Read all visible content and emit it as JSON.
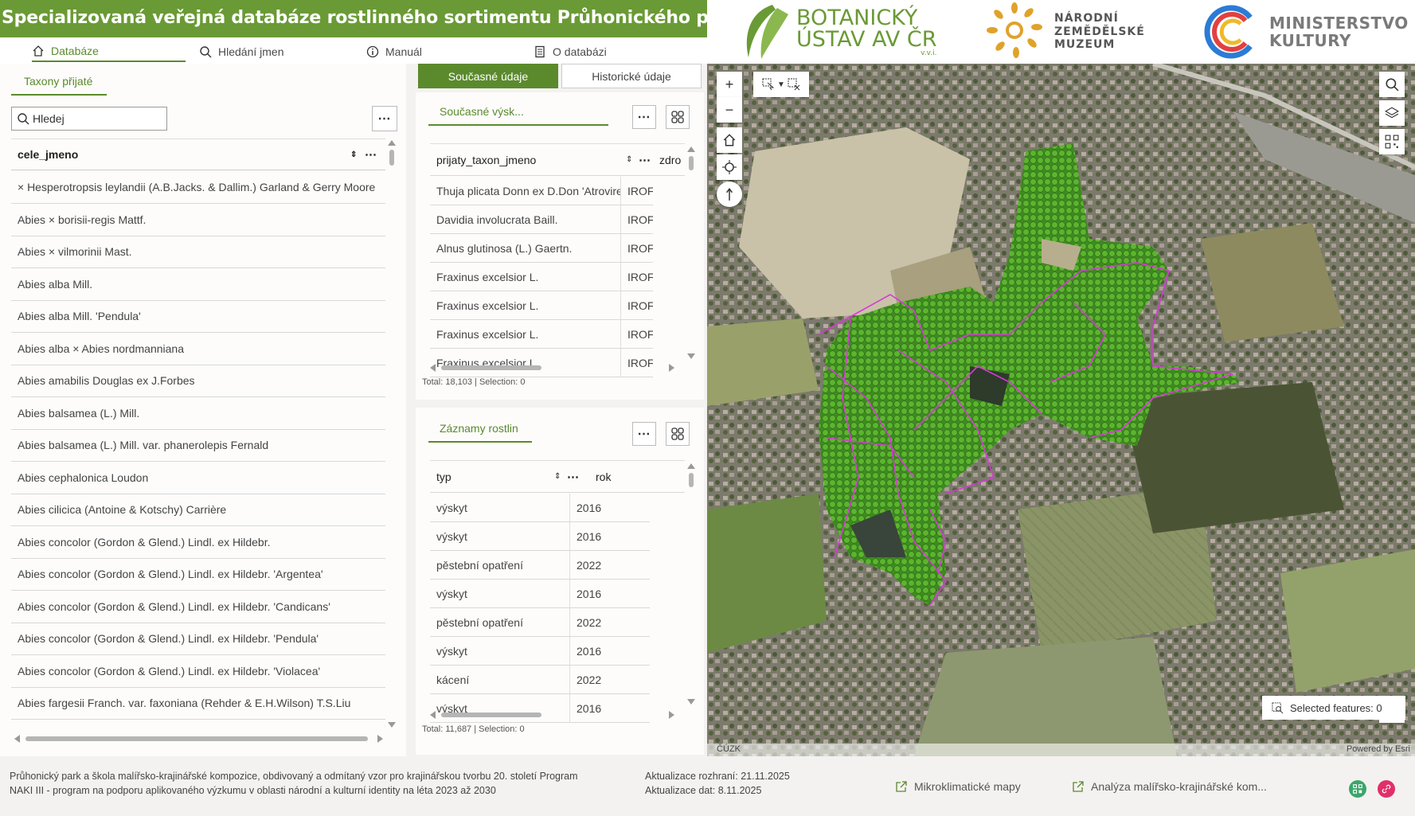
{
  "header": {
    "title": "Specializovaná veřejná databáze rostlinného sortimentu Průhonického parku",
    "accent": "#6a9a35",
    "nav": [
      {
        "label": "Databáze",
        "icon": "home-icon",
        "active": true
      },
      {
        "label": "Hledání jmen",
        "icon": "search-icon",
        "active": false
      },
      {
        "label": "Manuál",
        "icon": "info-icon",
        "active": false
      },
      {
        "label": "O databázi",
        "icon": "document-icon",
        "active": false
      }
    ],
    "logos": {
      "botanicky": {
        "line1": "BOTANICKÝ",
        "line2": "ÚSTAV AV ČR",
        "line3": "v.v.i."
      },
      "muzeum": {
        "line1": "NÁRODNÍ",
        "line2": "ZEMĚDĚLSKÉ",
        "line3": "MUZEUM"
      },
      "ministerstvo": {
        "line1": "MINISTERSTVO",
        "line2": "KULTURY"
      }
    }
  },
  "left_panel": {
    "tab": "Taxony přijaté",
    "search_placeholder": "Hledej",
    "column_header": "cele_jmeno",
    "rows": [
      "× Hesperotropsis leylandii (A.B.Jacks. & Dallim.) Garland & Gerry Moore",
      "Abies × borisii-regis Mattf.",
      "Abies × vilmorinii Mast.",
      "Abies alba Mill.",
      "Abies alba Mill. 'Pendula'",
      "Abies alba × Abies nordmanniana",
      "Abies amabilis Douglas ex J.Forbes",
      "Abies balsamea (L.) Mill.",
      "Abies balsamea (L.) Mill. var. phanerolepis Fernald",
      "Abies cephalonica Loudon",
      "Abies cilicica (Antoine & Kotschy) Carrière",
      "Abies concolor (Gordon & Glend.) Lindl. ex Hildebr.",
      "Abies concolor (Gordon & Glend.) Lindl. ex Hildebr. 'Argentea'",
      "Abies concolor (Gordon & Glend.) Lindl. ex Hildebr. 'Candicans'",
      "Abies concolor (Gordon & Glend.) Lindl. ex Hildebr. 'Pendula'",
      "Abies concolor (Gordon & Glend.) Lindl. ex Hildebr. 'Violacea'",
      "Abies fargesii Franch. var. faxoniana (Rehder & E.H.Wilson) T.S.Liu"
    ]
  },
  "mid_panel": {
    "tabs": [
      "Současné údaje",
      "Historické údaje"
    ],
    "table1": {
      "tab": "Současné výsk...",
      "col1": "prijaty_taxon_jmeno",
      "col2": "zdro",
      "rows": [
        {
          "name": "Thuja plicata Donn ex D.Don 'Atrovirens'",
          "src": "IROF"
        },
        {
          "name": "Davidia involucrata Baill.",
          "src": "IROF"
        },
        {
          "name": "Alnus glutinosa (L.) Gaertn.",
          "src": "IROF"
        },
        {
          "name": "Fraxinus excelsior L.",
          "src": "IROF"
        },
        {
          "name": "Fraxinus excelsior L.",
          "src": "IROF"
        },
        {
          "name": "Fraxinus excelsior L.",
          "src": "IROF"
        },
        {
          "name": "Fraxinus excelsior L.",
          "src": "IROF"
        }
      ],
      "footer": "Total: 18,103 | Selection: 0"
    },
    "table2": {
      "tab": "Záznamy rostlin",
      "col1": "typ",
      "col2": "rok",
      "rows": [
        {
          "typ": "výskyt",
          "rok": "2016"
        },
        {
          "typ": "výskyt",
          "rok": "2016"
        },
        {
          "typ": "pěstební opatření",
          "rok": "2022"
        },
        {
          "typ": "výskyt",
          "rok": "2016"
        },
        {
          "typ": "pěstební opatření",
          "rok": "2022"
        },
        {
          "typ": "výskyt",
          "rok": "2016"
        },
        {
          "typ": "kácení",
          "rok": "2022"
        },
        {
          "typ": "výskyt",
          "rok": "2016"
        }
      ],
      "footer": "Total: 11,687 | Selection: 0"
    }
  },
  "map": {
    "selected_features": "Selected features: 0",
    "attribution_left": "ČÚZK",
    "attribution_right": "Powered by Esri",
    "park_fill": "#4fa82a",
    "boundary_color": "#d63ad6"
  },
  "footer": {
    "desc_line1": "Průhonický park a škola malířsko-krajinářské kompozice, obdivovaný a odmítaný vzor pro krajinářskou tvorbu 20. století Program",
    "desc_line2": "NAKI III - program na podporu aplikovaného výzkumu v oblasti národní a kulturní identity na léta 2023 až 2030",
    "update_ui": "Aktualizace rozhraní: 21.11.2025",
    "update_data": "Aktualizace dat: 8.11.2025",
    "link1": "Mikroklimatické mapy",
    "link2": "Analýza malířsko-krajinářské kom..."
  }
}
